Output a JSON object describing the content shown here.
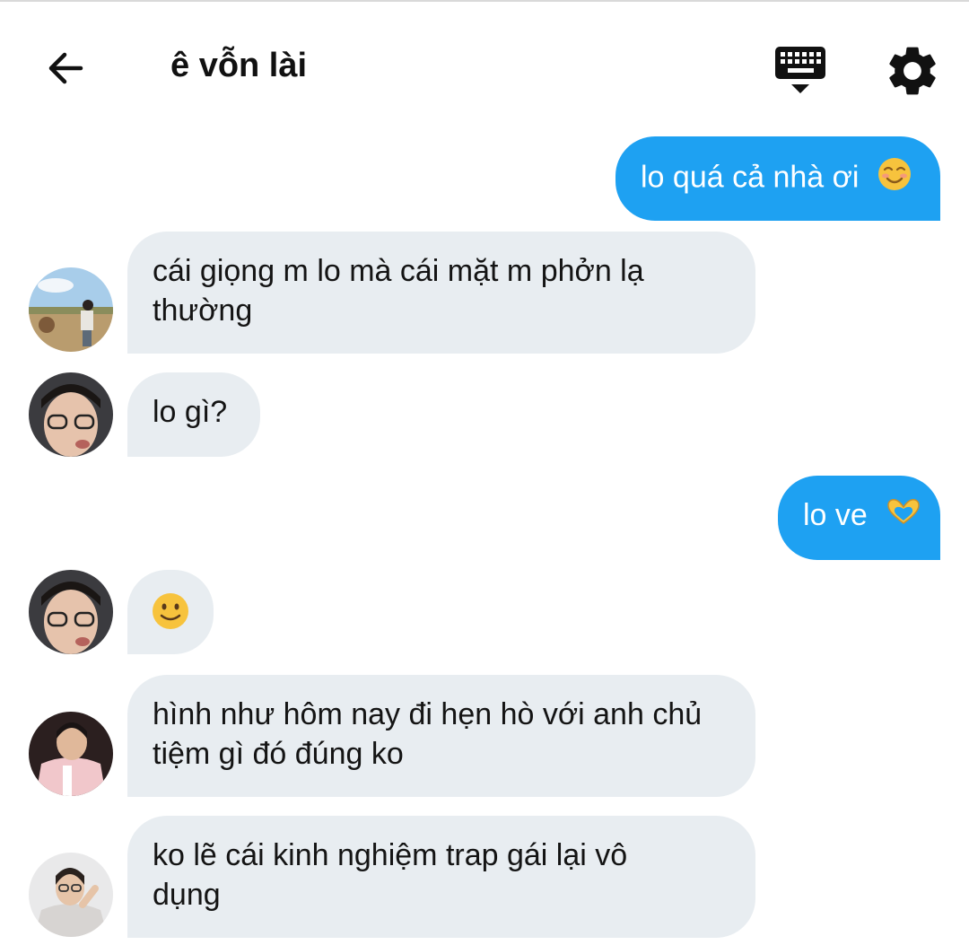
{
  "header": {
    "title": "ê vỗn lài"
  },
  "messages": [
    {
      "side": "out",
      "text": "lo quá cả nhà ơi",
      "emoji": "smiling-face-icon"
    },
    {
      "side": "in",
      "line1": "cái giọng m lo mà cái mặt m phởn lạ",
      "line2": "thường"
    },
    {
      "side": "in",
      "text": "lo gì?"
    },
    {
      "side": "out",
      "text": "lo ve",
      "emoji": "heart-hands-icon"
    },
    {
      "side": "in",
      "emoji": "slightly-smiling-face-icon"
    },
    {
      "side": "in",
      "line1": "hình như hôm nay đi hẹn hò với anh chủ",
      "line2": "tiệm gì đó đúng ko"
    },
    {
      "side": "in",
      "line1": "ko lẽ cái kinh nghiệm trap gái lại vô",
      "line2": "dụng"
    }
  ],
  "colors": {
    "outgoing_bubble": "#1ea1f2",
    "incoming_bubble": "#e8edf1",
    "header_text": "#111111"
  }
}
